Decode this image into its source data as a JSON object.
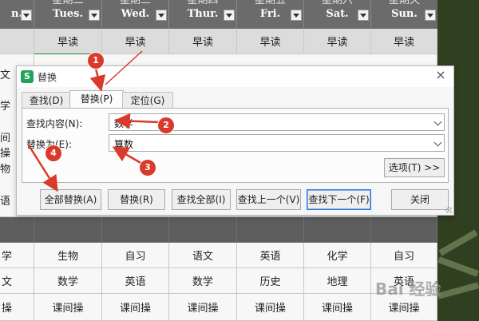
{
  "sheet": {
    "header": [
      {
        "line1": "",
        "line2": "n."
      },
      {
        "line1": "星期二",
        "line2": "Tues."
      },
      {
        "line1": "星期三",
        "line2": "Wed."
      },
      {
        "line1": "星期四",
        "line2": "Thur."
      },
      {
        "line1": "星期五",
        "line2": "Fri."
      },
      {
        "line1": "星期六",
        "line2": "Sat."
      },
      {
        "line1": "星期天",
        "line2": "Sun."
      }
    ],
    "row_morning": {
      "left": "",
      "cells": [
        "早读",
        "早读",
        "早读",
        "早读",
        "早读",
        "早读"
      ]
    },
    "left_fragments": [
      "文",
      "学",
      "间操",
      "物",
      "语"
    ],
    "row_a": {
      "left": "学",
      "cells": [
        "生物",
        "自习",
        "语文",
        "英语",
        "化学",
        "自习"
      ]
    },
    "row_b": {
      "left": "文",
      "cells": [
        "数学",
        "英语",
        "数学",
        "历史",
        "地理",
        "英语"
      ]
    },
    "row_c": {
      "left": "操",
      "cells": [
        "课间操",
        "课间操",
        "课间操",
        "课间操",
        "课间操",
        "课间操"
      ]
    }
  },
  "dialog": {
    "title": "替换",
    "app_icon": "S",
    "tabs": [
      "查找(D)",
      "替换(P)",
      "定位(G)"
    ],
    "find_label": "查找内容(N):",
    "find_value": "数学",
    "replace_label": "替换为(E):",
    "replace_value": "算数",
    "options_label": "选项(T) >>",
    "buttons": {
      "replace_all": "全部替换(A)",
      "replace": "替换(R)",
      "find_all": "查找全部(I)",
      "find_prev": "查找上一个(V)",
      "find_next": "查找下一个(F)",
      "close": "关闭"
    }
  },
  "annotations": [
    "1",
    "2",
    "3",
    "4"
  ],
  "watermark": "Bai 经验",
  "colors": {
    "header_bg": "#6b6b6b",
    "badge": "#d93a2b",
    "focus": "#2d74d6",
    "app_icon": "#1fa55a"
  }
}
